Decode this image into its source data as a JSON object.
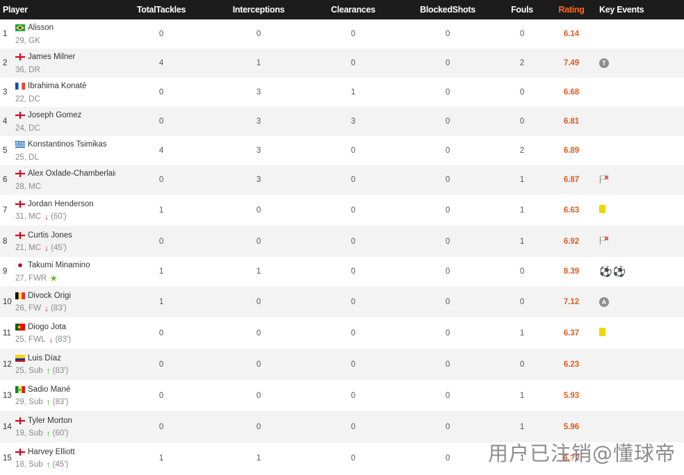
{
  "headers": {
    "player": "Player",
    "tackles": "TotalTackles",
    "interceptions": "Interceptions",
    "clearances": "Clearances",
    "blocked": "BlockedShots",
    "fouls": "Fouls",
    "rating": "Rating",
    "events": "Key Events"
  },
  "colors": {
    "rating": "#e8581c",
    "header_bg": "#1c1c1c",
    "sub_out": "#d62020",
    "sub_in": "#2aa82a",
    "yellow_card": "#f5d400"
  },
  "players": [
    {
      "num": "1",
      "name": "Alisson",
      "flag": "brazil",
      "age_pos": "29, GK",
      "tackles": "0",
      "interceptions": "0",
      "clearances": "0",
      "blocked": "0",
      "fouls": "0",
      "rating": "6.14"
    },
    {
      "num": "2",
      "name": "James Milner",
      "flag": "england",
      "age_pos": "36, DR",
      "tackles": "4",
      "interceptions": "1",
      "clearances": "0",
      "blocked": "0",
      "fouls": "2",
      "rating": "7.49",
      "badge": "T"
    },
    {
      "num": "3",
      "name": "Ibrahima Konaté",
      "flag": "france",
      "age_pos": "22, DC",
      "tackles": "0",
      "interceptions": "3",
      "clearances": "1",
      "blocked": "0",
      "fouls": "0",
      "rating": "6.68"
    },
    {
      "num": "4",
      "name": "Joseph Gomez",
      "flag": "england",
      "age_pos": "24, DC",
      "tackles": "0",
      "interceptions": "3",
      "clearances": "3",
      "blocked": "0",
      "fouls": "0",
      "rating": "6.81"
    },
    {
      "num": "5",
      "name": "Konstantinos Tsimikas",
      "flag": "greece",
      "age_pos": "25, DL",
      "tackles": "4",
      "interceptions": "3",
      "clearances": "0",
      "blocked": "0",
      "fouls": "2",
      "rating": "6.89"
    },
    {
      "num": "6",
      "name": "Alex Oxlade-Chamberlain",
      "flag": "england",
      "age_pos": "28, MC",
      "tackles": "0",
      "interceptions": "3",
      "clearances": "0",
      "blocked": "0",
      "fouls": "1",
      "rating": "6.87",
      "event": "offside-flag"
    },
    {
      "num": "7",
      "name": "Jordan Henderson",
      "flag": "england",
      "age_pos": "31, MC",
      "sub": "out",
      "minute": "(60')",
      "tackles": "1",
      "interceptions": "0",
      "clearances": "0",
      "blocked": "0",
      "fouls": "1",
      "rating": "6.63",
      "event": "yellow-card"
    },
    {
      "num": "8",
      "name": "Curtis Jones",
      "flag": "england",
      "age_pos": "21, MC",
      "sub": "out",
      "minute": "(45')",
      "tackles": "0",
      "interceptions": "0",
      "clearances": "0",
      "blocked": "0",
      "fouls": "1",
      "rating": "6.92",
      "event": "offside-flag"
    },
    {
      "num": "9",
      "name": "Takumi Minamino",
      "flag": "japan",
      "age_pos": "27, FWR",
      "star": true,
      "tackles": "1",
      "interceptions": "1",
      "clearances": "0",
      "blocked": "0",
      "fouls": "0",
      "rating": "8.39",
      "event": "two-goals"
    },
    {
      "num": "10",
      "name": "Divock Origi",
      "flag": "belgium",
      "age_pos": "26, FW",
      "sub": "out",
      "minute": "(83')",
      "tackles": "1",
      "interceptions": "0",
      "clearances": "0",
      "blocked": "0",
      "fouls": "0",
      "rating": "7.12",
      "badge": "A"
    },
    {
      "num": "11",
      "name": "Diogo Jota",
      "flag": "portugal",
      "age_pos": "25, FWL",
      "sub": "out",
      "minute": "(83')",
      "tackles": "0",
      "interceptions": "0",
      "clearances": "0",
      "blocked": "0",
      "fouls": "1",
      "rating": "6.37",
      "event": "yellow-card"
    },
    {
      "num": "12",
      "name": "Luis Díaz",
      "flag": "colombia",
      "age_pos": "25, Sub",
      "sub": "in",
      "minute": "(83')",
      "tackles": "0",
      "interceptions": "0",
      "clearances": "0",
      "blocked": "0",
      "fouls": "0",
      "rating": "6.23"
    },
    {
      "num": "13",
      "name": "Sadio Mané",
      "flag": "senegal",
      "age_pos": "29, Sub",
      "sub": "in",
      "minute": "(83')",
      "tackles": "0",
      "interceptions": "0",
      "clearances": "0",
      "blocked": "0",
      "fouls": "1",
      "rating": "5.93"
    },
    {
      "num": "14",
      "name": "Tyler Morton",
      "flag": "england",
      "age_pos": "19, Sub",
      "sub": "in",
      "minute": "(60')",
      "tackles": "0",
      "interceptions": "0",
      "clearances": "0",
      "blocked": "0",
      "fouls": "1",
      "rating": "5.96"
    },
    {
      "num": "15",
      "name": "Harvey Elliott",
      "flag": "england",
      "age_pos": "18, Sub",
      "sub": "in",
      "minute": "(45')",
      "tackles": "1",
      "interceptions": "1",
      "clearances": "0",
      "blocked": "0",
      "fouls": "1",
      "rating": "6.??"
    }
  ],
  "watermark": "用户已注销@懂球帝"
}
